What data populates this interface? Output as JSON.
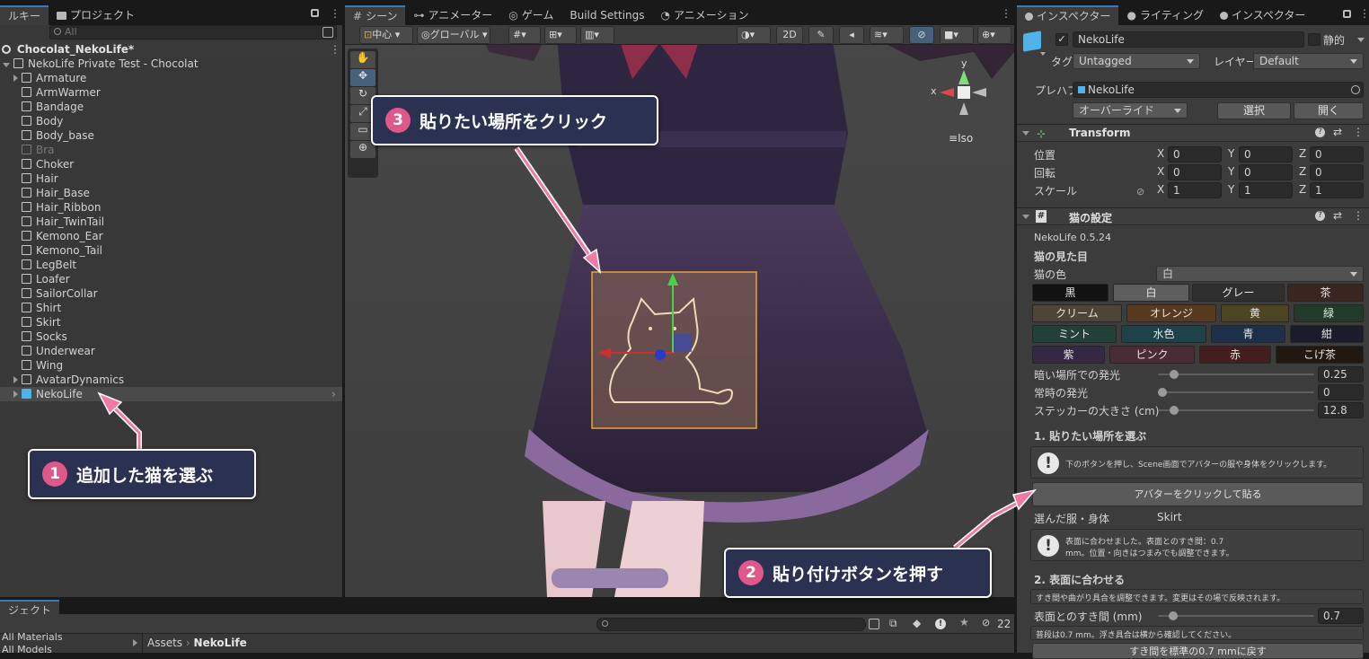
{
  "hierarchy": {
    "tabs": [
      "ルキー",
      "プロジェクト"
    ],
    "search_placeholder": "All",
    "scene_name": "Chocolat_NekoLife*",
    "root": "NekoLife Private Test - Chocolat",
    "items": [
      "Armature",
      "ArmWarmer",
      "Bandage",
      "Body",
      "Body_base",
      "Bra",
      "Choker",
      "Hair",
      "Hair_Base",
      "Hair_Ribbon",
      "Hair_TwinTail",
      "Kemono_Ear",
      "Kemono_Tail",
      "LegBelt",
      "Loafer",
      "SailorCollar",
      "Shirt",
      "Skirt",
      "Socks",
      "Underwear",
      "Wing",
      "AvatarDynamics",
      "NekoLife"
    ]
  },
  "scene": {
    "tabs": [
      "シーン",
      "アニメーター",
      "ゲーム",
      "Build Settings",
      "アニメーション"
    ],
    "pivot": "中心",
    "space": "グローバル",
    "mode_2d": "2D",
    "iso_label": "Iso",
    "gizmo_x": "x",
    "gizmo_y": "y"
  },
  "inspector": {
    "tabs": [
      "インスペクター",
      "ライティング",
      "インスペクター"
    ],
    "object_name": "NekoLife",
    "static_label": "静的",
    "tag_label": "タグ",
    "tag_value": "Untagged",
    "layer_label": "レイヤー",
    "layer_value": "Default",
    "prefab_label": "プレハブ",
    "prefab_value": "NekoLife",
    "override_label": "オーバーライド",
    "select_label": "選択",
    "open_label": "開く",
    "transform": {
      "title": "Transform",
      "position_label": "位置",
      "rotation_label": "回転",
      "scale_label": "スケール",
      "position": [
        "0",
        "0",
        "0"
      ],
      "rotation": [
        "0",
        "0",
        "0"
      ],
      "scale": [
        "1",
        "1",
        "1"
      ],
      "axis": [
        "X",
        "Y",
        "Z"
      ]
    },
    "cat": {
      "title": "猫の設定",
      "version": "NekoLife 0.5.24",
      "appearance_label": "猫の見た目",
      "color_label": "猫の色",
      "color_value": "白",
      "colors": [
        {
          "label": "黒",
          "bg": "#121212"
        },
        {
          "label": "白",
          "bg": "#5e5e5e"
        },
        {
          "label": "グレー",
          "bg": "#2f2f2f"
        },
        {
          "label": "茶",
          "bg": "#3a2620"
        },
        {
          "label": "クリーム",
          "bg": "#4e4537"
        },
        {
          "label": "オレンジ",
          "bg": "#573a1f"
        },
        {
          "label": "黄",
          "bg": "#4c4423"
        },
        {
          "label": "緑",
          "bg": "#213a2a"
        },
        {
          "label": "ミント",
          "bg": "#224037"
        },
        {
          "label": "水色",
          "bg": "#1f4149"
        },
        {
          "label": "青",
          "bg": "#1d2f4a"
        },
        {
          "label": "紺",
          "bg": "#191d2b"
        },
        {
          "label": "紫",
          "bg": "#352843"
        },
        {
          "label": "ピンク",
          "bg": "#4a2c37"
        },
        {
          "label": "赤",
          "bg": "#431e1e"
        },
        {
          "label": "こげ茶",
          "bg": "#211812"
        }
      ],
      "dark_glow_label": "暗い場所での発光",
      "dark_glow_value": "0.25",
      "dark_glow_fraction": 0.08,
      "always_glow_label": "常時の発光",
      "always_glow_value": "0",
      "always_glow_fraction": 0,
      "sticker_size_label": "ステッカーの大きさ (cm)",
      "sticker_size_value": "12.8",
      "sticker_size_fraction": 0.08,
      "step1_title": "1. 貼りたい場所を選ぶ",
      "step1_help": "下のボタンを押し、Scene画面でアバターの服や身体をクリックします。",
      "attach_button": "アバターをクリックして貼る",
      "selected_label": "選んだ服・身体",
      "selected_value": "Skirt",
      "fit_help_line1": "表面に合わせました。表面とのすき間：0.7",
      "fit_help_line2": "mm。位置・向きはつまみでも調整できます。",
      "step2_title": "2. 表面に合わせる",
      "step2_help": "すき間や曲がり具合を調整できます。変更はその場で反映されます。",
      "gap_label": "表面とのすき間 (mm)",
      "gap_value": "0.7",
      "gap_fraction": 0.05,
      "gap_note": "普段は0.7 mm。浮き具合は横から確認してください。",
      "reset_button": "すき間を標準の0.7 mmに戻す"
    }
  },
  "project": {
    "tab": "ジェクト",
    "left_items": [
      "All Materials",
      "All Models"
    ],
    "breadcrumb_root": "Assets",
    "breadcrumb_current": "NekoLife",
    "hidden_count": "22"
  },
  "callouts": {
    "c1_num": "1",
    "c1_text": "追加した猫を選ぶ",
    "c2_num": "2",
    "c2_text": "貼り付けボタンを押す",
    "c3_num": "3",
    "c3_text": "貼りたい場所をクリック"
  },
  "colors": {
    "accent": "#3a79bb",
    "callout_bg": "#2b3150",
    "callout_num": "#e0578a",
    "arrow": "#f07aa6"
  }
}
